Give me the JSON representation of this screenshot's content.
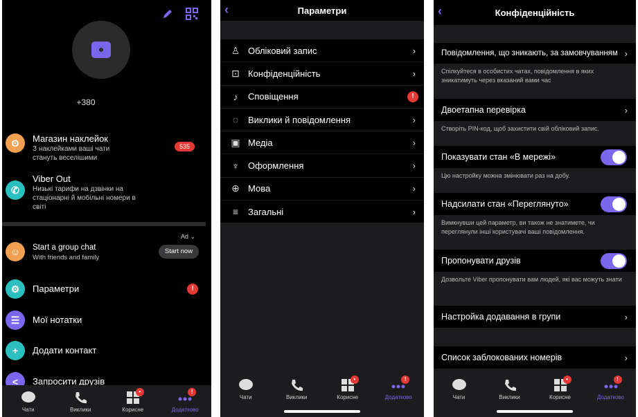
{
  "screen1": {
    "phone": "+380",
    "items": [
      {
        "title": "Магазин наклейок",
        "sub": "З наклейками ваші чати\nстануть веселішими",
        "badge": "535"
      },
      {
        "title": "Viber Out",
        "sub": "Низькі тарифи на дзвінки на\nстаціонарні й мобільні номери в\nсвіті"
      },
      {
        "title": "Start a group chat",
        "sub": "With friends and family",
        "ad": "Ad",
        "action": "Start now"
      },
      {
        "title": "Параметри",
        "badge": "!"
      },
      {
        "title": "Мої нотатки"
      },
      {
        "title": "Додати контакт"
      },
      {
        "title": "Запросити друзів"
      }
    ],
    "tabs": [
      {
        "label": "Чати"
      },
      {
        "label": "Виклики"
      },
      {
        "label": "Корисне",
        "badge": "•"
      },
      {
        "label": "Додатково",
        "badge": "!"
      }
    ]
  },
  "screen2": {
    "title": "Параметри",
    "rows": [
      {
        "label": "Обліковий запис",
        "icon": "person-icon"
      },
      {
        "label": "Конфіденційність",
        "icon": "lock-icon"
      },
      {
        "label": "Сповіщення",
        "icon": "bell-icon",
        "badge": "!"
      },
      {
        "label": "Виклики й повідомлення",
        "icon": "chat-icon"
      },
      {
        "label": "Медіа",
        "icon": "image-icon"
      },
      {
        "label": "Оформлення",
        "icon": "brush-icon"
      },
      {
        "label": "Мова",
        "icon": "globe-icon"
      },
      {
        "label": "Загальні",
        "icon": "list-icon"
      }
    ],
    "tabs": [
      {
        "label": "Чати"
      },
      {
        "label": "Виклики"
      },
      {
        "label": "Корисне",
        "badge": "•"
      },
      {
        "label": "Додатково",
        "badge": "!"
      }
    ]
  },
  "screen3": {
    "title": "Конфіденційність",
    "rows": [
      {
        "label": "Повідомлення, що зникають, за замовчуванням",
        "desc": "Спілкуйтеся в особистих чатах, повідомлення в яких зникатимуть через вказаний вами час"
      },
      {
        "label": "Двоетапна перевірка",
        "desc": "Створіть PIN-код, щоб захистити свій обліковий запис."
      },
      {
        "label": "Показувати стан «В мережі»",
        "desc": "Цю настройку можна змінювати раз на добу.",
        "toggle": true
      },
      {
        "label": "Надсилати стан «Переглянуто»",
        "desc": "Вимкнувши цей параметр, ви також не знатимете, чи переглянули інші користувачі ваші повідомлення.",
        "toggle": true
      },
      {
        "label": "Пропонувати друзів",
        "desc": "Дозвольте Viber пропонувати вам людей, які вас можуть знати",
        "toggle": true
      },
      {
        "label": "Настройка додавання в групи"
      },
      {
        "label": "Список заблокованих номерів"
      }
    ],
    "tabs": [
      {
        "label": "Чати"
      },
      {
        "label": "Виклики"
      },
      {
        "label": "Корисне",
        "badge": "•"
      },
      {
        "label": "Додатково",
        "badge": "!"
      }
    ]
  },
  "colors": {
    "accent": "#7b67ee",
    "badge": "#e53935",
    "orange": "#f0a050",
    "teal": "#2bbfc0"
  }
}
